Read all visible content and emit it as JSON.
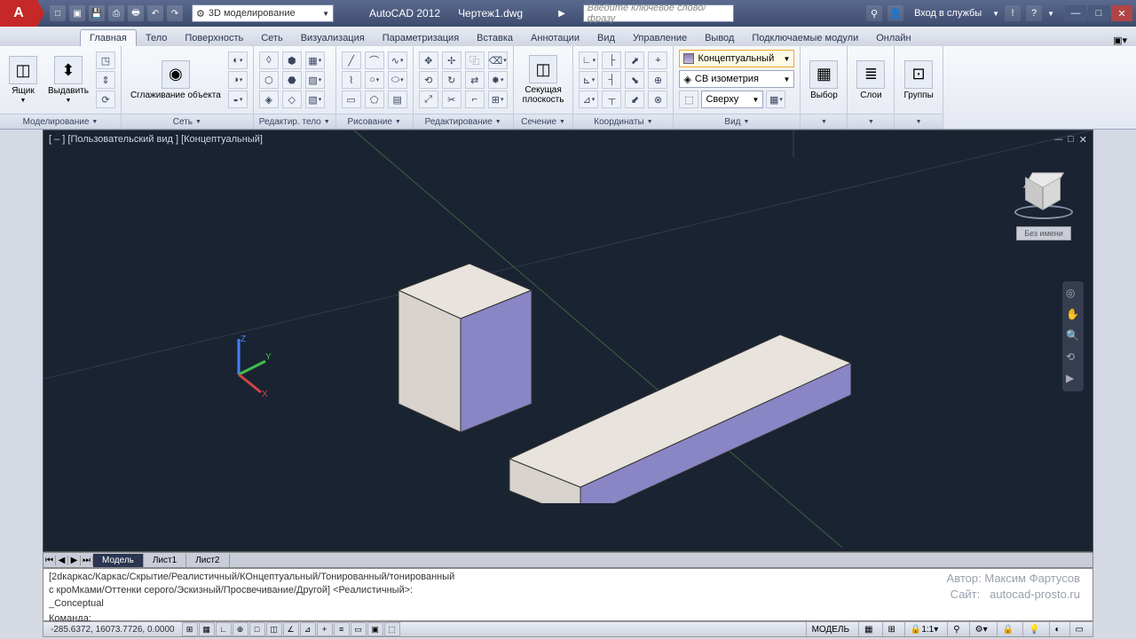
{
  "title": {
    "app": "AutoCAD 2012",
    "file": "Чертеж1.dwg"
  },
  "workspace": "3D моделирование",
  "search_placeholder": "Введите ключевое слово/фразу",
  "signin": "Вход в службы",
  "tabs": [
    "Главная",
    "Тело",
    "Поверхность",
    "Сеть",
    "Визуализация",
    "Параметризация",
    "Вставка",
    "Аннотации",
    "Вид",
    "Управление",
    "Вывод",
    "Подключаемые модули",
    "Онлайн"
  ],
  "active_tab": 0,
  "panels": {
    "modeling": {
      "title": "Моделирование",
      "box": "Ящик",
      "extrude": "Выдавить"
    },
    "mesh": {
      "title": "Сеть",
      "smooth": "Сглаживание объекта"
    },
    "solidedit": {
      "title": "Редактир. тело"
    },
    "draw": {
      "title": "Рисование"
    },
    "modify": {
      "title": "Редактирование"
    },
    "section": {
      "title": "Сечение",
      "secplane1": "Секущая",
      "secplane2": "плоскость"
    },
    "coords": {
      "title": "Координаты"
    },
    "view": {
      "title": "Вид",
      "style": "Концептуальный",
      "iso": "СВ изометрия",
      "top": "Сверху"
    },
    "selection": {
      "title": "",
      "label": "Выбор"
    },
    "layers": {
      "label": "Слои"
    },
    "groups": {
      "label": "Группы"
    }
  },
  "viewport": {
    "label": "[ – ] [Пользовательский вид ] [Концептуальный]",
    "viewcube_label": "Без имени"
  },
  "layout_tabs": [
    "Модель",
    "Лист1",
    "Лист2"
  ],
  "cmd": {
    "line1": "[2dкаркас/Каркас/Скрытие/Реалистичный/КОнцептуальный/Тонированный/тонированный",
    "line2": "с кроМками/Оттенки серого/Эскизный/Просвечивание/Другой] <Реалистичный>:",
    "line3": "_Conceptual",
    "prompt": "Команда:"
  },
  "watermark": {
    "author_label": "Автор:",
    "author": "Максим Фартусов",
    "site_label": "Сайт:",
    "site": "autocad-prosto.ru"
  },
  "status": {
    "coords": "-285.6372, 16073.7726, 0.0000",
    "space": "МОДЕЛЬ",
    "scale": "1:1"
  }
}
